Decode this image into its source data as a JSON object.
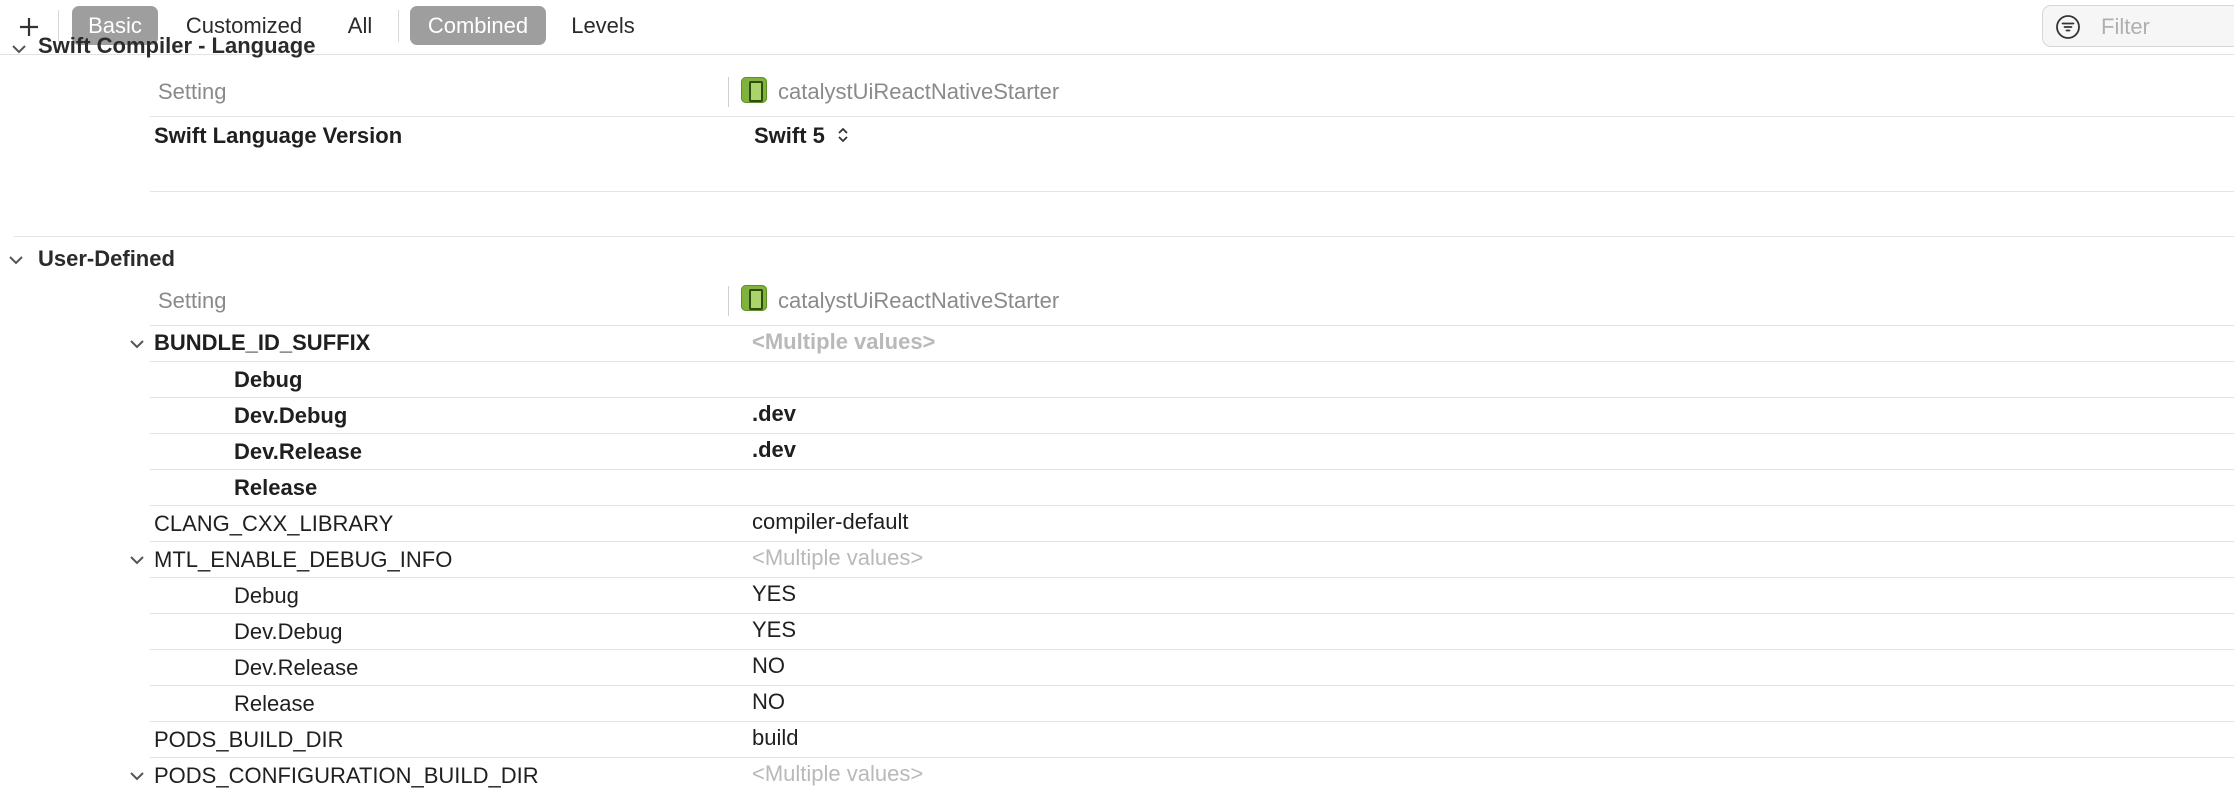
{
  "toolbar": {
    "segments": [
      {
        "label": "Basic",
        "active": true
      },
      {
        "label": "Customized",
        "active": false
      },
      {
        "label": "All",
        "active": false
      },
      {
        "label": "Combined",
        "active": true
      },
      {
        "label": "Levels",
        "active": false
      }
    ],
    "filter_placeholder": "Filter"
  },
  "swift_section": {
    "title": "Swift Compiler - Language",
    "col_setting": "Setting",
    "col_target": "catalystUiReactNativeStarter",
    "rows": [
      {
        "key": "Swift Language Version",
        "value": "Swift 5"
      }
    ]
  },
  "user_defined": {
    "title": "User-Defined",
    "col_setting": "Setting",
    "col_target": "catalystUiReactNativeStarter",
    "bundle_id_suffix": {
      "key": "BUNDLE_ID_SUFFIX",
      "value": "<Multiple values>",
      "children": [
        {
          "key": "Debug",
          "value": ""
        },
        {
          "key": "Dev.Debug",
          "value": ".dev"
        },
        {
          "key": "Dev.Release",
          "value": ".dev"
        },
        {
          "key": "Release",
          "value": ""
        }
      ]
    },
    "clang_cxx_library": {
      "key": "CLANG_CXX_LIBRARY",
      "value": "compiler-default"
    },
    "mtl_enable_debug_info": {
      "key": "MTL_ENABLE_DEBUG_INFO",
      "value": "<Multiple values>",
      "children": [
        {
          "key": "Debug",
          "value": "YES"
        },
        {
          "key": "Dev.Debug",
          "value": "YES"
        },
        {
          "key": "Dev.Release",
          "value": "NO"
        },
        {
          "key": "Release",
          "value": "NO"
        }
      ]
    },
    "pods_build_dir": {
      "key": "PODS_BUILD_DIR",
      "value": "build"
    },
    "pods_configuration_build_dir": {
      "key": "PODS_CONFIGURATION_BUILD_DIR",
      "value": "<Multiple values>"
    }
  },
  "colors": {
    "segment_active_bg": "#9e9e9e",
    "target_icon": "#7fb33a",
    "muted_text": "#b9b9b9"
  },
  "icons": {
    "add": "plus-icon",
    "filter": "filter-icon",
    "disclosure": "chevron-down-icon",
    "target": "app-target-icon",
    "stepper": "up-down-chevron-icon"
  }
}
